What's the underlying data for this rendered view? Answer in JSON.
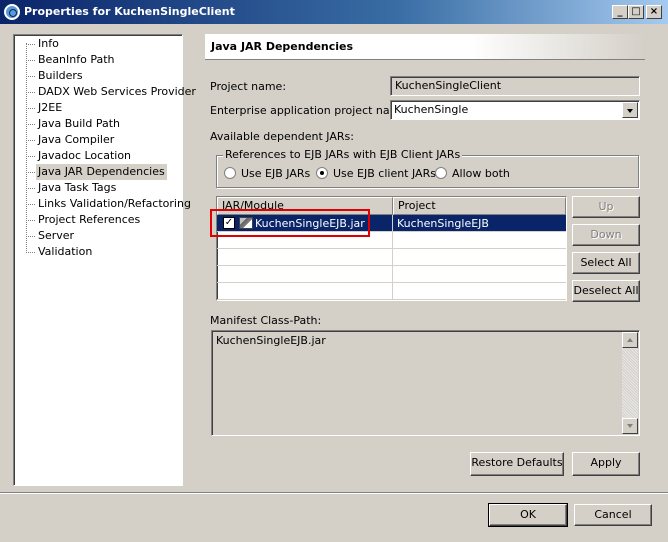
{
  "window": {
    "title": "Properties for KuchenSingleClient",
    "controls": {
      "minimize": "_",
      "maximize": "□",
      "close": "×"
    }
  },
  "tree": {
    "items": [
      {
        "label": "Info"
      },
      {
        "label": "BeanInfo Path"
      },
      {
        "label": "Builders"
      },
      {
        "label": "DADX Web Services Provider"
      },
      {
        "label": "J2EE"
      },
      {
        "label": "Java Build Path"
      },
      {
        "label": "Java Compiler"
      },
      {
        "label": "Javadoc Location"
      },
      {
        "label": "Java JAR Dependencies"
      },
      {
        "label": "Java Task Tags"
      },
      {
        "label": "Links Validation/Refactoring"
      },
      {
        "label": "Project References"
      },
      {
        "label": "Server"
      },
      {
        "label": "Validation"
      }
    ],
    "selected": "Java JAR Dependencies"
  },
  "page": {
    "title": "Java JAR Dependencies",
    "project_name_label": "Project name:",
    "project_name_value": "KuchenSingleClient",
    "ear_label": "Enterprise application project name:",
    "ear_value": "KuchenSingle",
    "available_label": "Available dependent JARs:",
    "group": {
      "title": "References to EJB JARs with EJB Client JARs",
      "options": [
        {
          "label": "Use EJB JARs",
          "selected": false
        },
        {
          "label": "Use EJB client JARs",
          "selected": true
        },
        {
          "label": "Allow both",
          "selected": false
        }
      ]
    },
    "table": {
      "headers": [
        "JAR/Module",
        "Project"
      ],
      "rows": [
        {
          "module": "KuchenSingleEJB.jar",
          "project": "KuchenSingleEJB",
          "checked": true
        }
      ]
    },
    "side_buttons": {
      "up": "Up",
      "down": "Down",
      "select_all": "Select All",
      "deselect_all": "Deselect All"
    },
    "manifest_label": "Manifest Class-Path:",
    "manifest_value": "KuchenSingleEJB.jar",
    "restore_defaults": "Restore Defaults",
    "apply": "Apply"
  },
  "footer": {
    "ok": "OK",
    "cancel": "Cancel"
  },
  "colors": {
    "selection": "#0a246a",
    "highlight_box": "#e00000",
    "dialog_bg": "#d4d0c8"
  }
}
